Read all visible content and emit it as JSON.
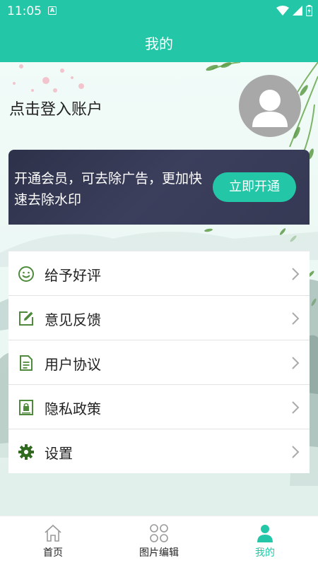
{
  "status_bar": {
    "time": "11:05",
    "notification_badge": "A"
  },
  "header": {
    "title": "我的"
  },
  "profile": {
    "login_prompt": "点击登入账户"
  },
  "vip": {
    "promo_text": "开通会员，可去除广告，更加快速去除水印",
    "button_label": "立即开通"
  },
  "menu": [
    {
      "label": "给予好评",
      "icon": "smile-icon"
    },
    {
      "label": "意见反馈",
      "icon": "edit-icon"
    },
    {
      "label": "用户协议",
      "icon": "document-icon"
    },
    {
      "label": "隐私政策",
      "icon": "lock-icon"
    },
    {
      "label": "设置",
      "icon": "gear-icon"
    }
  ],
  "bottom_nav": [
    {
      "label": "首页",
      "icon": "home-icon",
      "active": false
    },
    {
      "label": "图片编辑",
      "icon": "grid-icon",
      "active": false
    },
    {
      "label": "我的",
      "icon": "person-icon",
      "active": true
    }
  ],
  "colors": {
    "accent": "#23c7a8",
    "icon_green": "#4f8a3c",
    "vip_bg": "#353954"
  }
}
